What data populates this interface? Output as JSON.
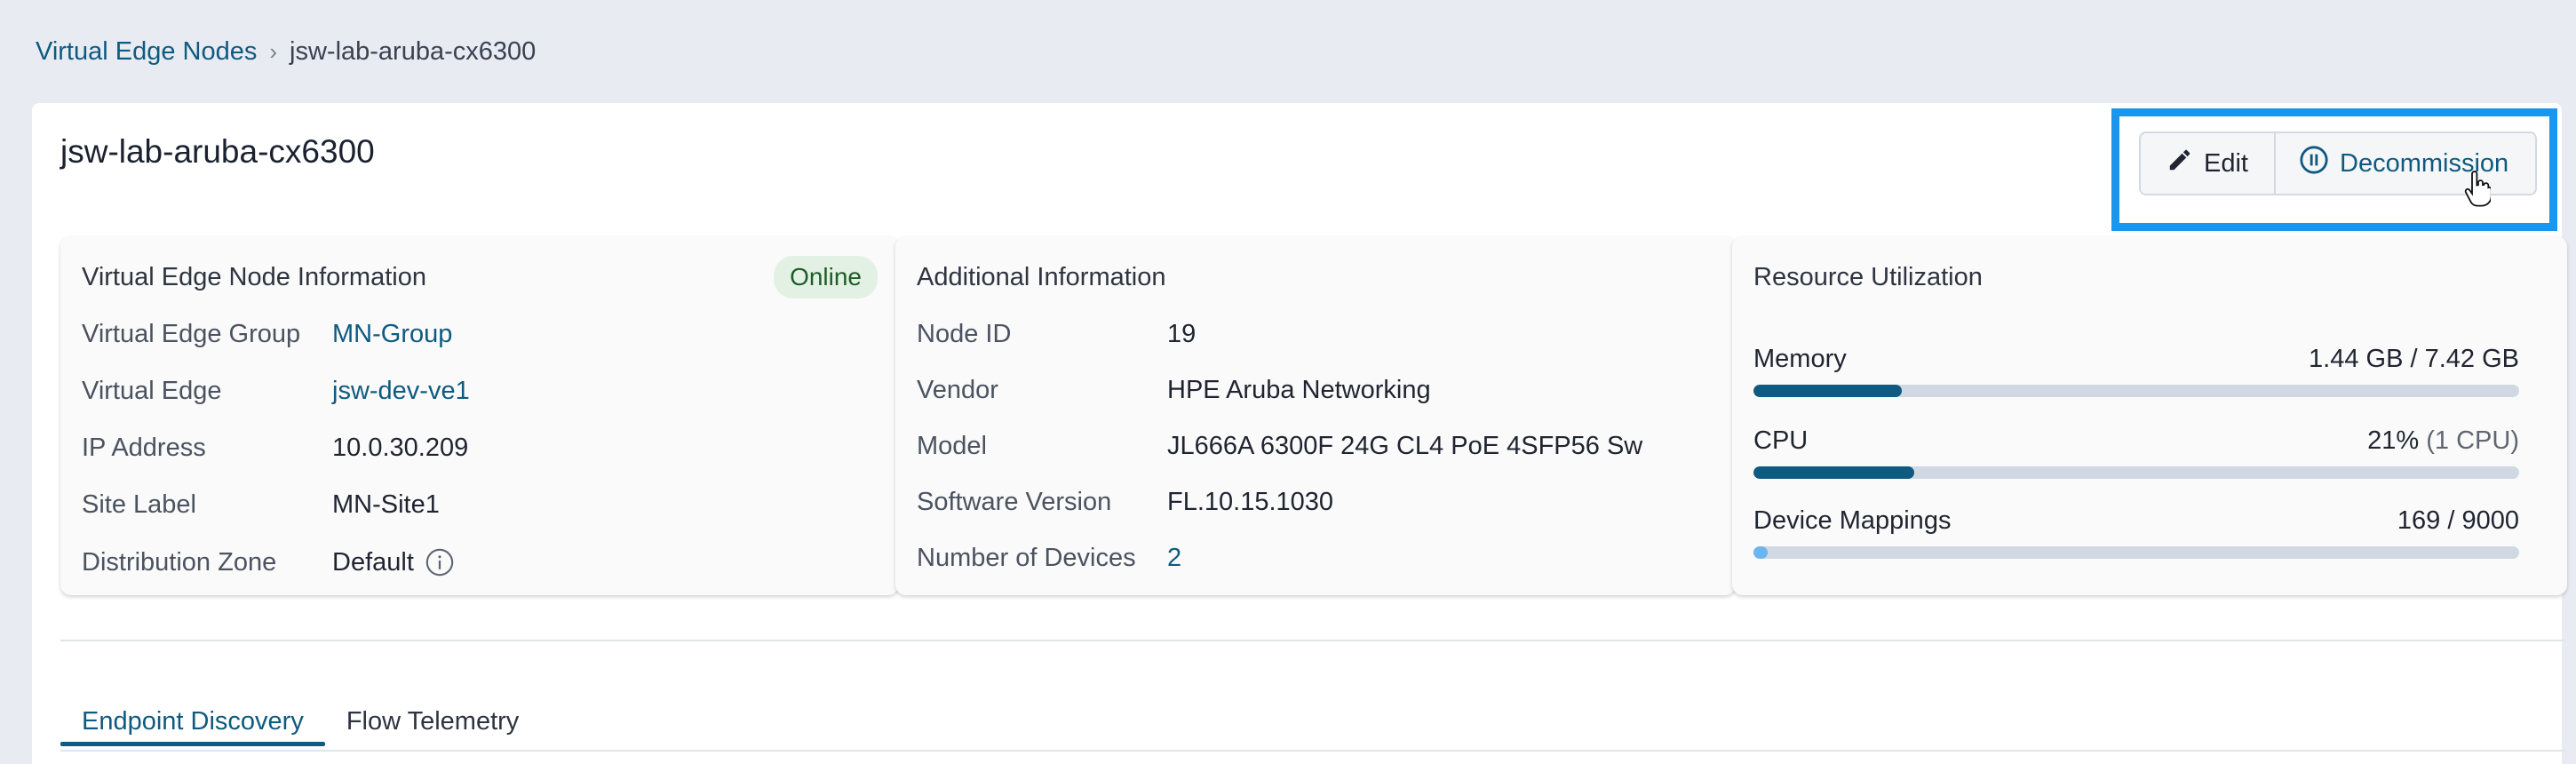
{
  "breadcrumb": {
    "parent": "Virtual Edge Nodes",
    "separator": "›",
    "current": "jsw-lab-aruba-cx6300"
  },
  "node": {
    "title": "jsw-lab-aruba-cx6300"
  },
  "actions": {
    "edit_label": "Edit",
    "decommission_label": "Decommission"
  },
  "info_card": {
    "title": "Virtual Edge Node Information",
    "status": "Online",
    "rows": [
      {
        "label": "Virtual Edge Group",
        "value": "MN-Group"
      },
      {
        "label": "Virtual Edge",
        "value": "jsw-dev-ve1"
      },
      {
        "label": "IP Address",
        "value": "10.0.30.209"
      },
      {
        "label": "Site Label",
        "value": "MN-Site1"
      },
      {
        "label": "Distribution Zone",
        "value": "Default"
      }
    ]
  },
  "additional_card": {
    "title": "Additional Information",
    "rows": [
      {
        "label": "Node ID",
        "value": "19"
      },
      {
        "label": "Vendor",
        "value": "HPE Aruba Networking"
      },
      {
        "label": "Model",
        "value": "JL666A 6300F 24G CL4 PoE 4SFP56 Sw"
      },
      {
        "label": "Software Version",
        "value": "FL.10.15.1030"
      },
      {
        "label": "Number of Devices",
        "value": "2"
      }
    ]
  },
  "resource_card": {
    "title": "Resource Utilization",
    "items": [
      {
        "name": "Memory",
        "value": "1.44 GB / 7.42 GB",
        "sub": "",
        "fraction": 0.194,
        "color": "#0f5a80"
      },
      {
        "name": "CPU",
        "value": "21%",
        "sub": "(1 CPU)",
        "fraction": 0.21,
        "color": "#0f5a80"
      },
      {
        "name": "Device Mappings",
        "value": "169 / 9000",
        "sub": "",
        "fraction": 0.019,
        "color": "#6cb6f0"
      }
    ]
  },
  "tabs": [
    {
      "label": "Endpoint Discovery",
      "active": true
    },
    {
      "label": "Flow Telemetry",
      "active": false
    }
  ],
  "colors": {
    "accent": "#0f5a80",
    "highlight": "#1a96ee",
    "online_bg": "#e3f1e4",
    "online_text": "#1e5d28"
  }
}
